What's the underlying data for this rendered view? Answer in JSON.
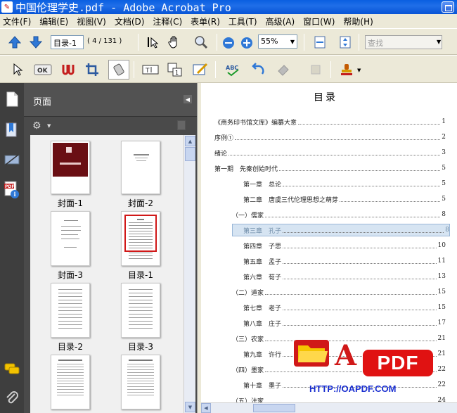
{
  "window": {
    "title": "中国伦理学史.pdf - Adobe Acrobat Pro",
    "app_icon": "acrobat-icon"
  },
  "menu": [
    "文件(F)",
    "编辑(E)",
    "视图(V)",
    "文档(D)",
    "注释(C)",
    "表单(R)",
    "工具(T)",
    "高级(A)",
    "窗口(W)",
    "帮助(H)"
  ],
  "toolbar": {
    "page_label": "目录-1",
    "page_count": "( 4 / 131 )",
    "zoom": "55%",
    "find_placeholder": "查找"
  },
  "panel": {
    "title": "页面",
    "thumbnails": [
      "封面-1",
      "封面-2",
      "封面-3",
      "目录-1",
      "目录-2",
      "目录-3",
      "",
      ""
    ],
    "selected": "目录-1"
  },
  "document": {
    "title": "目录",
    "toc": [
      {
        "label": "《商务印书馆文库》编纂大意",
        "page": "1",
        "indent": 0
      },
      {
        "label": "序例①",
        "page": "2",
        "indent": 0
      },
      {
        "label": "绪论",
        "page": "3",
        "indent": 0
      },
      {
        "label": "第一期　先秦创始时代",
        "page": "5",
        "indent": 0
      },
      {
        "label": "第一章　总论",
        "page": "5",
        "indent": 2
      },
      {
        "label": "第二章　唐虞三代伦理思想之萌芽",
        "page": "5",
        "indent": 2
      },
      {
        "label": "（一）儒家",
        "page": "8",
        "indent": 1
      },
      {
        "label": "第三章　孔子",
        "page": "8",
        "indent": 2,
        "highlight": true
      },
      {
        "label": "第四章　子思",
        "page": "10",
        "indent": 2
      },
      {
        "label": "第五章　孟子",
        "page": "11",
        "indent": 2
      },
      {
        "label": "第六章　荀子",
        "page": "13",
        "indent": 2
      },
      {
        "label": "（二）道家",
        "page": "15",
        "indent": 1
      },
      {
        "label": "第七章　老子",
        "page": "15",
        "indent": 2
      },
      {
        "label": "第八章　庄子",
        "page": "17",
        "indent": 2
      },
      {
        "label": "（三）农家",
        "page": "21",
        "indent": 1
      },
      {
        "label": "第九章　许行",
        "page": "21",
        "indent": 2
      },
      {
        "label": "（四）墨家",
        "page": "22",
        "indent": 1
      },
      {
        "label": "第十章　墨子",
        "page": "22",
        "indent": 2
      },
      {
        "label": "（五）法家",
        "page": "24",
        "indent": 1
      }
    ]
  },
  "watermark": {
    "letter": "A",
    "badge": "PDF",
    "url": "HTTP://OAPDF.COM"
  },
  "colors": {
    "title_bar": "#0a5fe0",
    "panel_bg": "#4a4a4a",
    "selection_red": "#d01818",
    "toc_highlight": "#d6e4f2"
  }
}
